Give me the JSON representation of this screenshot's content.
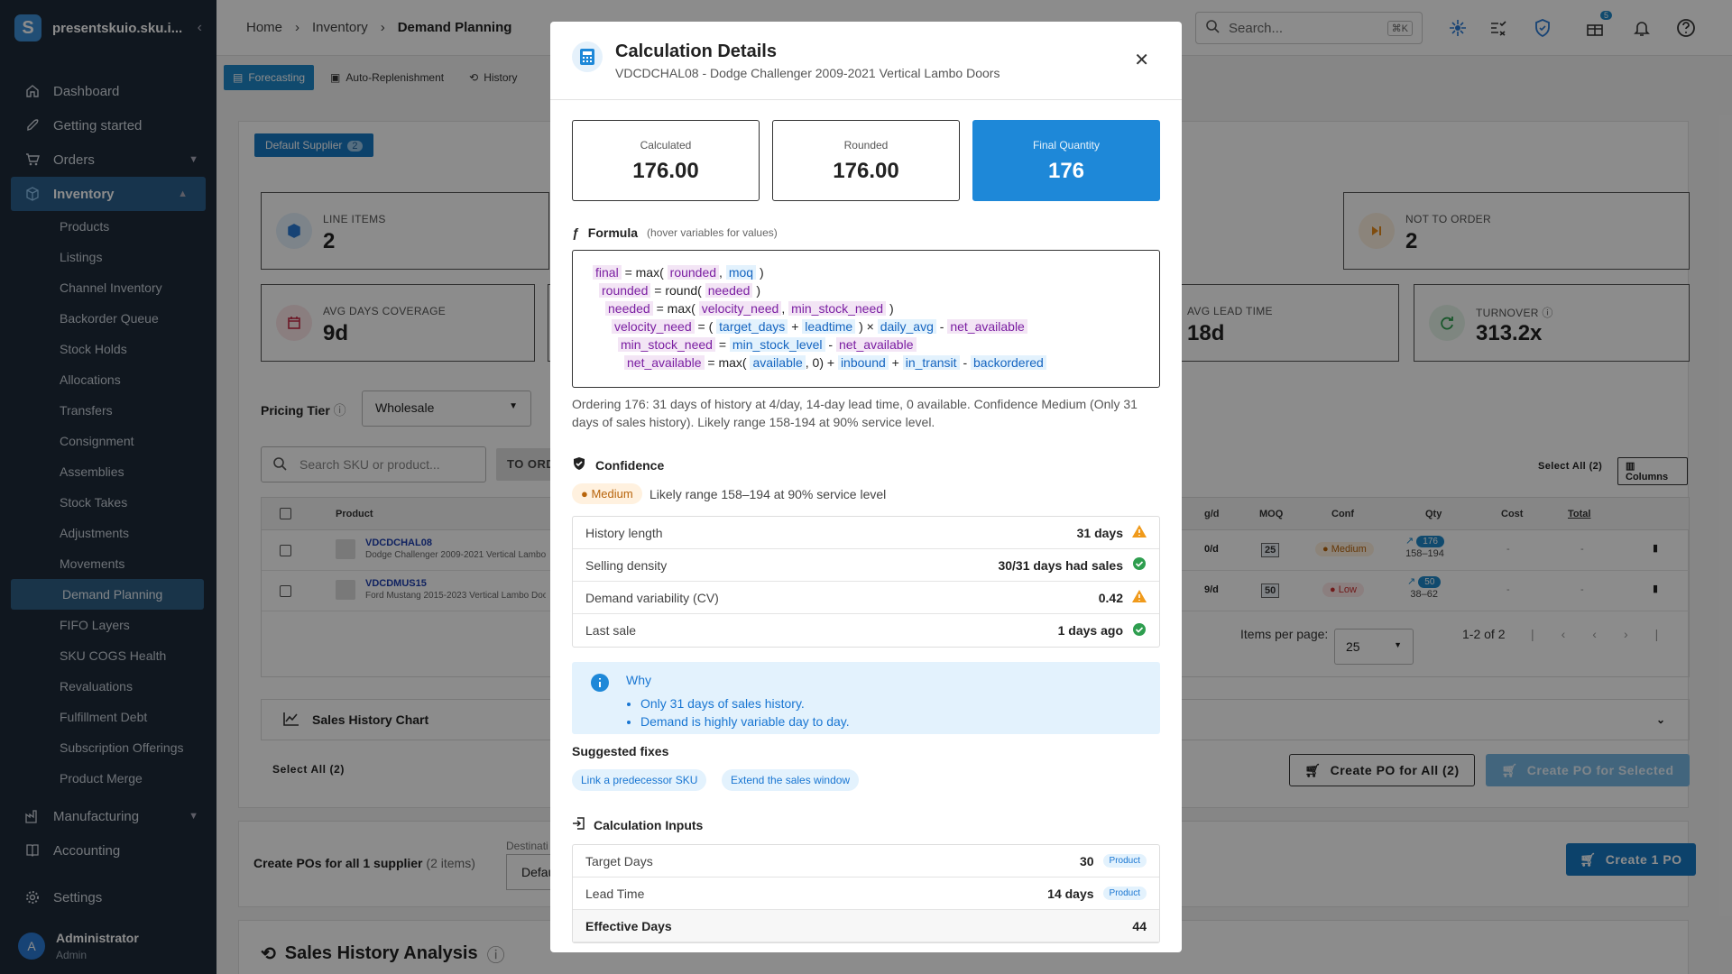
{
  "sidebar": {
    "org": "presentskuio.sku.i...",
    "items": [
      {
        "label": "Dashboard"
      },
      {
        "label": "Getting started"
      },
      {
        "label": "Orders"
      },
      {
        "label": "Inventory"
      }
    ],
    "inventory_sub": [
      "Products",
      "Listings",
      "Channel Inventory",
      "Backorder Queue",
      "Stock Holds",
      "Allocations",
      "Transfers",
      "Consignment",
      "Assemblies",
      "Stock Takes",
      "Adjustments",
      "Movements",
      "Demand Planning",
      "FIFO Layers",
      "SKU COGS Health",
      "Revaluations",
      "Fulfillment Debt",
      "Subscription Offerings",
      "Product Merge"
    ],
    "bottom_items": [
      {
        "label": "Manufacturing"
      },
      {
        "label": "Accounting"
      },
      {
        "label": "Settings"
      }
    ],
    "user": {
      "initial": "A",
      "name": "Administrator",
      "role": "Admin"
    }
  },
  "topbar": {
    "breadcrumb": [
      "Home",
      "Inventory",
      "Demand Planning"
    ],
    "search_placeholder": "Search...",
    "search_shortcut": "⌘K",
    "gift_badge": "5"
  },
  "tabs": [
    "Forecasting",
    "Auto-Replenishment",
    "History"
  ],
  "page": {
    "supplier_button": "Default Supplier",
    "supplier_count": "2",
    "stats": {
      "line_items": {
        "label": "LINE ITEMS",
        "value": "2"
      },
      "not_to_order": {
        "label": "NOT TO ORDER",
        "value": "2"
      },
      "avg_days_coverage": {
        "label": "AVG DAYS COVERAGE",
        "value": "9d"
      },
      "avg_lead_time": {
        "label": "AVG LEAD TIME",
        "value": "18d"
      },
      "turnover": {
        "label": "TURNOVER",
        "value": "313.2x"
      }
    },
    "pricing_tier_label": "Pricing Tier",
    "pricing_tier_value": "Wholesale",
    "search_sku_placeholder": "Search SKU or product...",
    "to_order_label": "TO ORD",
    "select_all_top": "Select All (2)",
    "columns_button": "Columns",
    "table_headers": {
      "product": "Product",
      "avg": "g/d",
      "moq": "MOQ",
      "conf": "Conf",
      "qty": "Qty",
      "cost": "Cost",
      "total": "Total"
    },
    "rows": [
      {
        "sku": "VDCDCHAL08",
        "name": "Dodge Challenger 2009-2021 Vertical Lambo Doors",
        "avg": "0/d",
        "moq": "25",
        "conf": "Medium",
        "qty": "176",
        "range": "158–194",
        "cost": "-",
        "total": "-"
      },
      {
        "sku": "VDCDMUS15",
        "name": "Ford Mustang 2015-2023 Vertical Lambo Doors",
        "avg": "9/d",
        "moq": "50",
        "conf": "Low",
        "qty": "50",
        "range": "38–62",
        "cost": "-",
        "total": "-"
      }
    ],
    "items_per_page_label": "Items per page:",
    "items_per_page": "25",
    "page_range": "1-2 of 2",
    "sales_history_chart": "Sales History Chart",
    "select_all_bottom": "Select All (2)",
    "create_po_all": "Create PO for All (2)",
    "create_po_selected": "Create PO for Selected",
    "create_pos_label": "Create POs for all 1 supplier",
    "create_pos_count": "(2 items)",
    "destination_label": "Destinati",
    "destination_value": "Defau",
    "create_1_po": "Create 1 PO",
    "sales_history_analysis": "Sales History Analysis"
  },
  "modal": {
    "title": "Calculation Details",
    "subtitle": "VDCDCHAL08 - Dodge Challenger 2009-2021 Vertical Lambo Doors",
    "summary": [
      {
        "label": "Calculated",
        "value": "176.00"
      },
      {
        "label": "Rounded",
        "value": "176.00"
      },
      {
        "label": "Final Quantity",
        "value": "176"
      }
    ],
    "formula_title": "Formula",
    "formula_hint": "(hover variables for values)",
    "formula": {
      "l1": [
        "final",
        "= max(",
        "rounded",
        ",",
        "moq",
        ")"
      ],
      "l2": [
        "rounded",
        "= round(",
        "needed",
        ")"
      ],
      "l3": [
        "needed",
        "= max(",
        "velocity_need",
        ",",
        "min_stock_need",
        ")"
      ],
      "l4": [
        "velocity_need",
        "= (",
        "target_days",
        "+",
        "leadtime",
        ") ×",
        "daily_avg",
        "-",
        "net_available"
      ],
      "l5": [
        "min_stock_need",
        "=",
        "min_stock_level",
        "-",
        "net_available"
      ],
      "l6": [
        "net_available",
        "= max(",
        "available",
        ", 0) +",
        "inbound",
        "+",
        "in_transit",
        "-",
        "backordered"
      ]
    },
    "explanation": "Ordering 176: 31 days of history at 4/day, 14-day lead time, 0 available. Confidence Medium (Only 31 days of sales history). Likely range 158-194 at 90% service level.",
    "confidence_title": "Confidence",
    "confidence_level": "Medium",
    "confidence_range": "Likely range 158–194 at 90% service level",
    "checks": [
      {
        "label": "History length",
        "value": "31 days",
        "status": "warn"
      },
      {
        "label": "Selling density",
        "value": "30/31 days had sales",
        "status": "ok"
      },
      {
        "label": "Demand variability (CV)",
        "value": "0.42",
        "status": "warn"
      },
      {
        "label": "Last sale",
        "value": "1 days ago",
        "status": "ok"
      }
    ],
    "why_title": "Why",
    "why_items": [
      "Only 31 days of sales history.",
      "Demand is highly variable day to day."
    ],
    "suggested_title": "Suggested fixes",
    "fixes": [
      "Link a predecessor SKU",
      "Extend the sales window"
    ],
    "inputs_title": "Calculation Inputs",
    "inputs": [
      {
        "label": "Target Days",
        "value": "30",
        "tag": "Product"
      },
      {
        "label": "Lead Time",
        "value": "14 days",
        "tag": "Product"
      },
      {
        "label": "Effective Days",
        "value": "44"
      }
    ]
  },
  "colors": {
    "sidebar": "#1e2b3a",
    "accent": "#1e88d8",
    "warn": "#f09a1b",
    "ok": "#2e9e4f"
  }
}
